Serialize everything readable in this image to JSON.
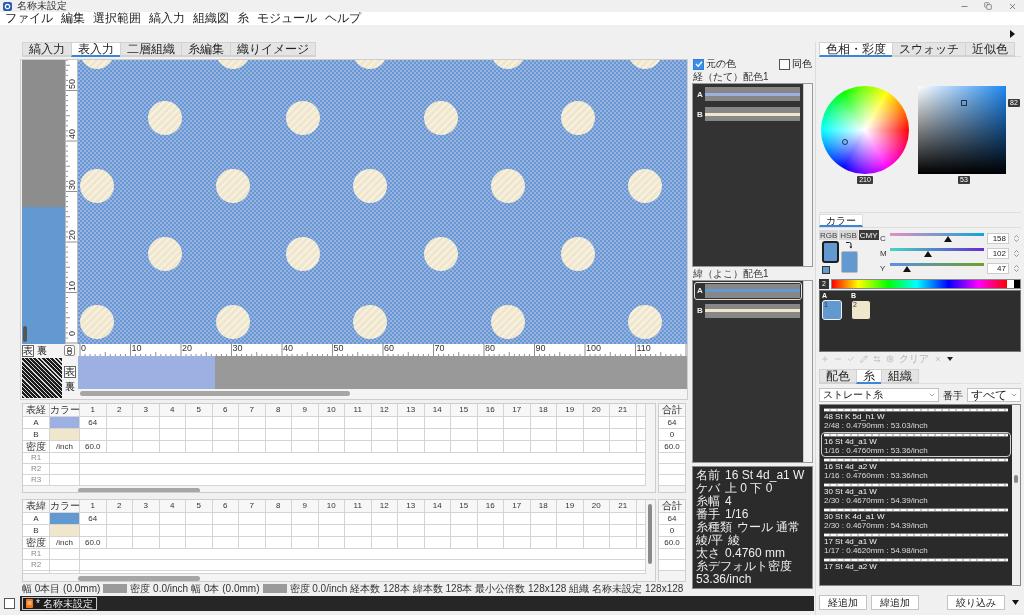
{
  "window": {
    "title": "名称未設定"
  },
  "menu": [
    "ファイル",
    "編集",
    "選択範囲",
    "縞入力",
    "組織図",
    "糸",
    "モジュール",
    "ヘルプ"
  ],
  "tabs": [
    {
      "label": "縞入力",
      "selected": false
    },
    {
      "label": "表入力",
      "selected": true
    },
    {
      "label": "二層組織",
      "selected": false
    },
    {
      "label": "糸編集",
      "selected": false
    },
    {
      "label": "織りイメージ",
      "selected": false
    }
  ],
  "canvas": {
    "vertical_ruler": [
      "50",
      "40",
      "30",
      "20",
      "10",
      "0"
    ],
    "horizontal_ruler": [
      "0",
      "10",
      "20",
      "30",
      "40",
      "50",
      "60",
      "70",
      "80",
      "90",
      "100",
      "110"
    ],
    "side_toggles": [
      {
        "label": "表",
        "selected": true
      },
      {
        "label": "裏",
        "selected": false
      }
    ],
    "thumbnail_toggles": [
      {
        "label": "表",
        "selected": true
      },
      {
        "label": "裏",
        "selected": false
      }
    ]
  },
  "warp_table": {
    "corner": "表経",
    "color_header": "カラー",
    "columns": [
      "1",
      "2",
      "3",
      "4",
      "5",
      "6",
      "7",
      "8",
      "9",
      "10",
      "11",
      "12",
      "13",
      "14",
      "15",
      "16",
      "17",
      "18",
      "19",
      "20",
      "21"
    ],
    "rows": [
      {
        "kind": "yarn",
        "label": "A",
        "color": "#9db0e2",
        "values": [
          "64"
        ]
      },
      {
        "kind": "yarn",
        "label": "B",
        "color": "#efe6cc"
      },
      {
        "kind": "density",
        "label": "密度",
        "unit": "/inch",
        "values": [
          "60.0"
        ]
      },
      {
        "kind": "extra",
        "label": "R1"
      },
      {
        "kind": "extra",
        "label": "R2"
      },
      {
        "kind": "extra",
        "label": "R3"
      }
    ],
    "total_header": "合計",
    "totals": [
      "64",
      "0",
      "60.0"
    ]
  },
  "weft_table": {
    "corner": "表緯",
    "color_header": "カラー",
    "columns": [
      "1",
      "2",
      "3",
      "4",
      "5",
      "6",
      "7",
      "8",
      "9",
      "10",
      "11",
      "12",
      "13",
      "14",
      "15",
      "16",
      "17",
      "18",
      "19",
      "20",
      "21"
    ],
    "rows": [
      {
        "kind": "yarn",
        "label": "A",
        "color": "#6199d0",
        "values": [
          "64"
        ]
      },
      {
        "kind": "yarn",
        "label": "B",
        "color": "#efe6cc"
      },
      {
        "kind": "density",
        "label": "密度",
        "unit": "/inch",
        "values": [
          "60.0"
        ]
      },
      {
        "kind": "extra",
        "label": "R1"
      },
      {
        "kind": "extra",
        "label": "R2"
      }
    ],
    "total_header": "合計",
    "totals": [
      "64",
      "0",
      "60.0"
    ]
  },
  "status_bar": {
    "groups": [
      {
        "position": "幅 0本目 (0.0mm)",
        "density": "密度 0.0/inch"
      },
      {
        "position": "幅 0本 (0.0mm)",
        "density": "密度 0.0/inch"
      }
    ],
    "counts": [
      "経本数 128本",
      "緯本数 128本",
      "最小公倍数 128x128",
      "組織 名称未設定 128x128"
    ]
  },
  "bottom_bar": {
    "checkbox": {
      "checked": false
    },
    "documents": [
      {
        "label": "* 名称未設定",
        "selected": true
      }
    ]
  },
  "yarn_colors": {
    "original_color": {
      "label": "元の色",
      "checked": true
    },
    "same_color": {
      "label": "同色",
      "checked": false
    },
    "warp": {
      "title": "経（たて）配色1",
      "items": [
        {
          "label": "A",
          "color": "#9db0e2",
          "selected": false
        },
        {
          "label": "B",
          "color": "#efe6cc",
          "selected": false
        }
      ]
    },
    "weft": {
      "title": "緯（よこ）配色1",
      "items": [
        {
          "label": "A",
          "color": "#6199d0",
          "selected": true
        },
        {
          "label": "B",
          "color": "#efe6cc",
          "selected": false
        }
      ]
    }
  },
  "yarn_info": [
    {
      "label": "名前",
      "value": "16 St 4d_a1 W"
    },
    {
      "label": "ケバ",
      "value": "上 0 下 0"
    },
    {
      "label": "糸幅",
      "value": "4"
    },
    {
      "label": "番手",
      "value": "1/16"
    },
    {
      "label": "糸種類",
      "value": "ウール 通常"
    },
    {
      "label": "綾/平",
      "value": "綾"
    },
    {
      "label": "太さ",
      "value": "0.4760 mm"
    },
    {
      "label": "糸デフォルト密度",
      "value": "53.36/inch"
    }
  ],
  "color_tabs": [
    {
      "label": "色相・彩度",
      "selected": true
    },
    {
      "label": "スウォッチ",
      "selected": false
    },
    {
      "label": "近似色",
      "selected": false
    }
  ],
  "picker": {
    "hue": "210",
    "value": "82",
    "saturation": "53"
  },
  "color_panel": {
    "title": "カラー",
    "modes": [
      {
        "label": "RGB",
        "selected": false
      },
      {
        "label": "HSB",
        "selected": false
      },
      {
        "label": "CMY",
        "selected": true
      }
    ],
    "sliders": [
      {
        "label": "C",
        "level": 0.62,
        "value": "158"
      },
      {
        "label": "M",
        "level": 0.4,
        "value": "102"
      },
      {
        "label": "Y",
        "level": 0.18,
        "value": "47"
      }
    ],
    "spectrum_index": "2"
  },
  "palette": [
    {
      "group": "A",
      "number": "1",
      "color": "#6199d0",
      "selected": true
    },
    {
      "group": "B",
      "number": "2",
      "color": "#efe6cc",
      "selected": false
    }
  ],
  "palette_toolbar": {
    "disabled": true,
    "clear_label": "クリア"
  },
  "lower_tabs": [
    {
      "label": "配色",
      "selected": false
    },
    {
      "label": "糸",
      "selected": true
    },
    {
      "label": "組織",
      "selected": false
    }
  ],
  "filters": {
    "yarn_type": "ストレート糸",
    "count_label": "番手",
    "count": "すべて"
  },
  "yarn_list": [
    {
      "name": "48 St K 5d_h1 W",
      "spec": "2/48 : 0.4790mm : 53.03/inch",
      "selected": false
    },
    {
      "name": "16 St 4d_a1 W",
      "spec": "1/16 : 0.4760mm : 53.36/inch",
      "selected": true
    },
    {
      "name": "16 St 4d_a2 W",
      "spec": "1/16 : 0.4760mm : 53.36/inch",
      "selected": false
    },
    {
      "name": "30 St 4d_a1 W",
      "spec": "2/30 : 0.4670mm : 54.39/inch",
      "selected": false
    },
    {
      "name": "30 St K 4d_a1 W",
      "spec": "2/30 : 0.4670mm : 54.39/inch",
      "selected": false
    },
    {
      "name": "17 St 4d_a1 W",
      "spec": "1/17 : 0.4620mm : 54.98/inch",
      "selected": false
    },
    {
      "name": "17 St 4d_a2 W",
      "selected": false
    }
  ],
  "buttons": {
    "add_warp": "経追加",
    "add_weft": "緯追加",
    "filter": "絞り込み"
  }
}
